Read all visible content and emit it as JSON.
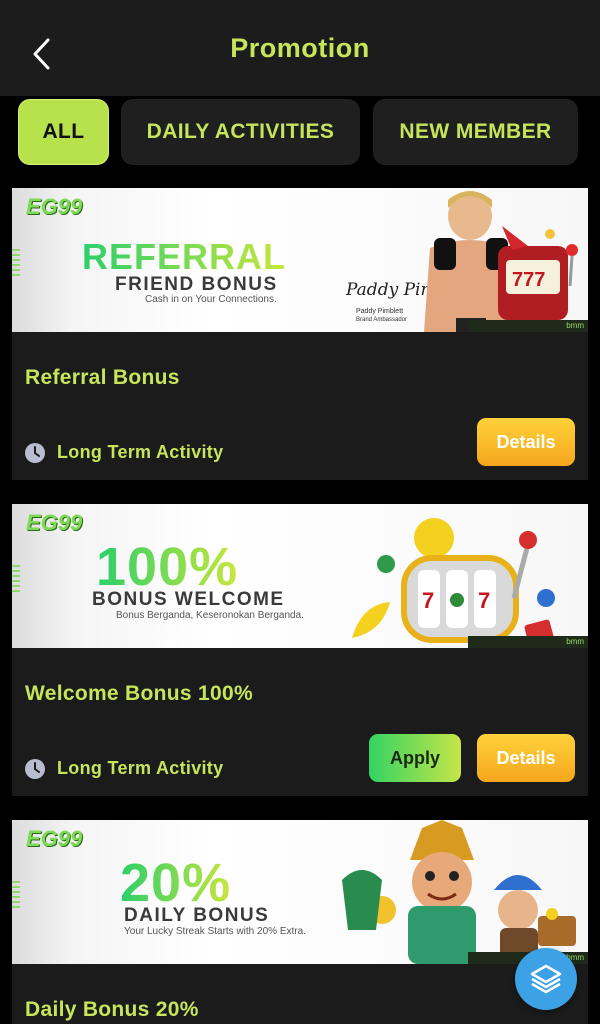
{
  "header": {
    "title": "Promotion"
  },
  "tabs": [
    {
      "label": "ALL",
      "active": true
    },
    {
      "label": "DAILY ACTIVITIES",
      "active": false
    },
    {
      "label": "NEW MEMBER",
      "active": false
    }
  ],
  "promos": [
    {
      "banner": {
        "logo": "EG99",
        "headline": "REFERRAL",
        "subline": "FRIEND BONUS",
        "tagline": "Cash in on Your Connections.",
        "signature": "Paddy Pimblett",
        "caption": "Paddy Pimblett",
        "caption2": "Brand Ambassador",
        "brand": "bmm"
      },
      "title": "Referral Bonus",
      "term": "Long Term Activity",
      "details_label": "Details"
    },
    {
      "banner": {
        "logo": "EG99",
        "headline": "100%",
        "subline": "BONUS WELCOME",
        "tagline": "Bonus Berganda, Keseronokan Berganda.",
        "brand": "bmm"
      },
      "title": "Welcome Bonus 100%",
      "term": "Long Term Activity",
      "apply_label": "Apply",
      "details_label": "Details"
    },
    {
      "banner": {
        "logo": "EG99",
        "headline": "20%",
        "subline": "DAILY BONUS",
        "tagline": "Your Lucky Streak Starts with 20% Extra.",
        "brand": "bmm"
      },
      "title": "Daily Bonus 20%"
    }
  ],
  "colors": {
    "accent": "#c6e55a",
    "active_tab": "#b7e24b",
    "details": "#f6a61d",
    "fab": "#3da1e6"
  },
  "icons": {
    "back": "chevron-left-icon",
    "term": "clock-icon",
    "fab": "layers-icon"
  }
}
